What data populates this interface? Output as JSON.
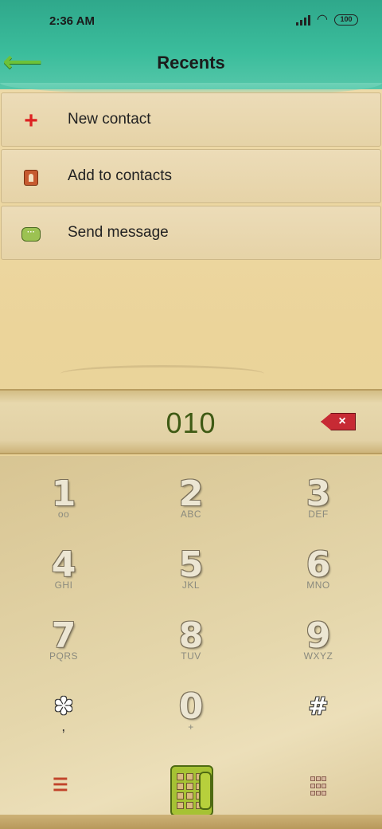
{
  "status": {
    "time": "2:36 AM",
    "battery": "100"
  },
  "header": {
    "title": "Recents"
  },
  "menu": {
    "items": [
      {
        "label": "New contact",
        "icon": "plus-icon"
      },
      {
        "label": "Add to contacts",
        "icon": "contact-card-icon"
      },
      {
        "label": "Send message",
        "icon": "message-icon"
      }
    ]
  },
  "dialer": {
    "number": "010"
  },
  "keys": [
    {
      "digit": "1",
      "sub": "ᴏᴏ"
    },
    {
      "digit": "2",
      "sub": "ABC"
    },
    {
      "digit": "3",
      "sub": "DEF"
    },
    {
      "digit": "4",
      "sub": "GHI"
    },
    {
      "digit": "5",
      "sub": "JKL"
    },
    {
      "digit": "6",
      "sub": "MNO"
    },
    {
      "digit": "7",
      "sub": "PQRS"
    },
    {
      "digit": "8",
      "sub": "TUV"
    },
    {
      "digit": "9",
      "sub": "WXYZ"
    },
    {
      "digit": "✽",
      "sub": ","
    },
    {
      "digit": "0",
      "sub": "+"
    },
    {
      "digit": "#",
      "sub": ""
    }
  ],
  "colors": {
    "header": "#3bbd9c",
    "number": "#3f5a14",
    "backspace": "#c72a34",
    "call": "#a6c234"
  }
}
